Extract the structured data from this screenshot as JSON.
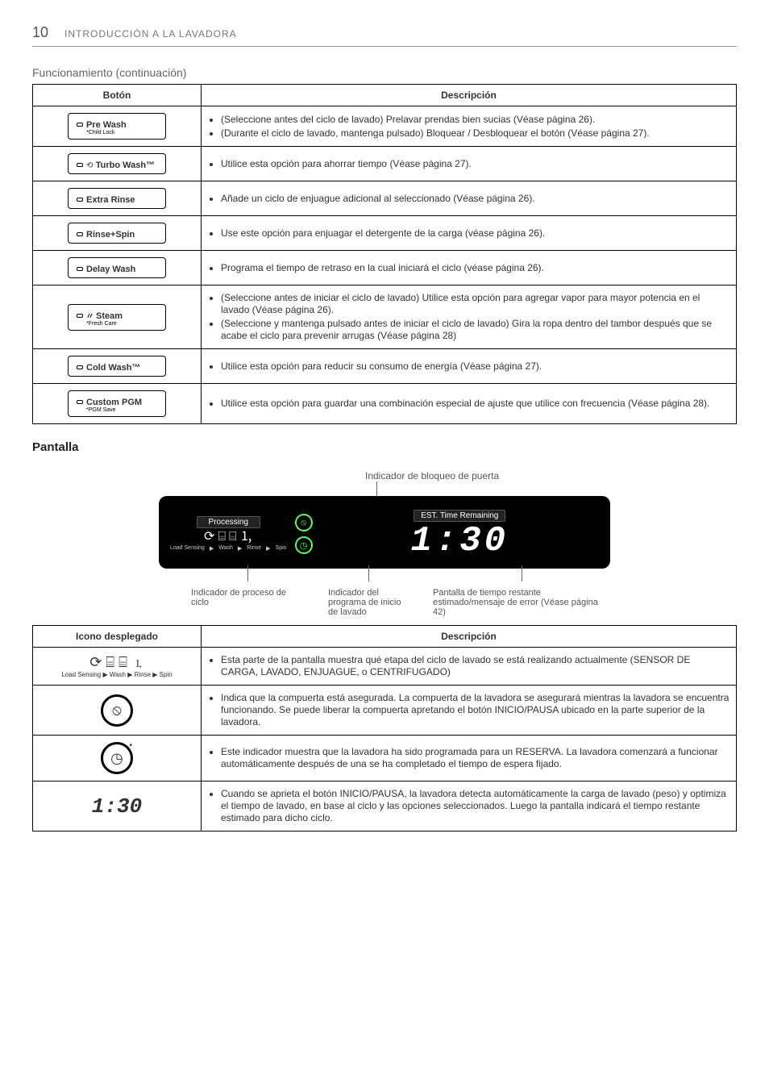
{
  "page": {
    "number": "10",
    "section": "INTRODUCCIÓN A LA LAVADORA"
  },
  "headings": {
    "funcionamiento": "Funcionamiento (continuación)",
    "pantalla": "Pantalla"
  },
  "table1": {
    "col_button": "Botón",
    "col_desc": "Descripción",
    "rows": [
      {
        "btn_main": "Pre Wash",
        "btn_sub": "*Child Lock",
        "desc": [
          "(Seleccione antes del ciclo de lavado) Prelavar prendas bien sucias (Véase página 26).",
          "(Durante el ciclo de lavado, mantenga pulsado) Bloquear / Desbloquear el botón (Véase página 27)."
        ]
      },
      {
        "btn_main": "Turbo Wash™",
        "btn_prefix_icon": "spinner",
        "desc": [
          "Utilice esta opción para ahorrar tiempo (Véase página 27)."
        ]
      },
      {
        "btn_main": "Extra Rinse",
        "desc": [
          "Añade un ciclo de enjuague adicional al seleccionado (Véase página 26)."
        ]
      },
      {
        "btn_main": "Rinse+Spin",
        "desc": [
          "Use este opción  para enjuagar el detergente de la carga (véase página 26)."
        ]
      },
      {
        "btn_main": "Delay Wash",
        "desc": [
          "Programa el tiempo de retraso en la cual iniciará el ciclo (véase página 26)."
        ]
      },
      {
        "btn_main": "Steam",
        "btn_sub": "*Fresh Care",
        "btn_prefix_icon": "steam",
        "desc": [
          "(Seleccione antes de iniciar el ciclo de lavado) Utilice esta opción para agregar vapor para mayor potencia en el lavado (Véase página 26).",
          "(Seleccione y mantenga pulsado antes de iniciar el ciclo de lavado) Gira la ropa dentro del tambor después que se acabe el ciclo para prevenir arrugas (Véase página 28)"
        ]
      },
      {
        "btn_main": "Cold Wash™",
        "desc": [
          "Utilice esta opción para reducir su consumo de energía (Véase página 27)."
        ]
      },
      {
        "btn_main": "Custom PGM",
        "btn_sub": "*PGM Save",
        "desc": [
          "Utilice esta opción para guardar una combinación especial de ajuste que utilice con frecuencia (Véase página 28)."
        ]
      }
    ]
  },
  "display": {
    "lock_label": "Indicador de bloqueo de puerta",
    "processing_label": "Processing",
    "est_label": "EST. Time Remaining",
    "stages": {
      "load": "Load Sensing",
      "wash": "Wash",
      "rinse": "Rinse",
      "spin": "Spin"
    },
    "time_value": "1:30",
    "pointers": {
      "cycle": "Indicador de proceso de ciclo",
      "program": "Indicador del programa de inicio de lavado",
      "remaining": "Pantalla de tiempo restante estimado/mensaje de error (Véase página 42)"
    }
  },
  "table2": {
    "col_icon": "Icono desplegado",
    "col_desc": "Descripción",
    "rows": [
      {
        "icon_kind": "stages",
        "icon_stages_line": "Load Sensing ▶ Wash ▶ Rinse ▶ Spin",
        "desc": [
          "Esta parte de la pantalla muestra qué etapa del ciclo de lavado se está realizando actualmente (SENSOR DE CARGA, LAVADO, ENJUAGUE, o CENTRIFUGADO)"
        ]
      },
      {
        "icon_kind": "lock",
        "desc": [
          "Indica que la compuerta está asegurada. La compuerta de la lavadora se asegurará mientras la lavadora se encuentra funcionando. Se puede liberar la compuerta apretando el botón INICIO/PAUSA ubicado en la parte superior de la lavadora."
        ]
      },
      {
        "icon_kind": "clock",
        "desc": [
          "Este indicador muestra que la lavadora ha sido programada para un RESERVA. La lavadora comenzará a funcionar automáticamente después de una se ha completado el tiempo de espera fijado."
        ]
      },
      {
        "icon_kind": "time",
        "icon_time_value": "1:30",
        "desc": [
          "Cuando se aprieta el botón INICIO/PAUSA, la lavadora detecta automáticamente la carga de lavado (peso) y optimiza el tiempo de lavado, en base al ciclo y las opciones seleccionados. Luego la pantalla indicará el tiempo restante estimado para dicho ciclo."
        ]
      }
    ]
  }
}
